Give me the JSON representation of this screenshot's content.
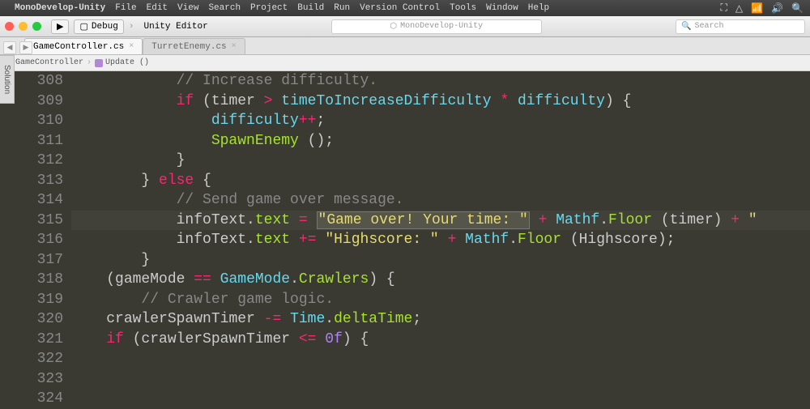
{
  "menubar": {
    "app": "MonoDevelop-Unity",
    "items": [
      "File",
      "Edit",
      "View",
      "Search",
      "Project",
      "Build",
      "Run",
      "Version Control",
      "Tools",
      "Window",
      "Help"
    ]
  },
  "toolbar": {
    "config": "Debug",
    "target": "Unity Editor",
    "center_title": "MonoDevelop-Unity",
    "search_placeholder": "Search"
  },
  "tabs": [
    {
      "label": "GameController.cs",
      "active": true
    },
    {
      "label": "TurretEnemy.cs",
      "active": false
    }
  ],
  "breadcrumb": {
    "class": "GameController",
    "method": "Update ()"
  },
  "sidebar_tab": "Solution",
  "lines": {
    "start": 308,
    "rows": [
      {
        "n": 308,
        "indent": "            ",
        "tokens": [
          {
            "t": "// Increase difficulty.",
            "c": "cmt"
          }
        ]
      },
      {
        "n": 309,
        "indent": "            ",
        "tokens": [
          {
            "t": "if",
            "c": "kw"
          },
          {
            "t": " (timer ",
            "c": "pn"
          },
          {
            "t": ">",
            "c": "op"
          },
          {
            "t": " timeToIncreaseDifficulty ",
            "c": "id"
          },
          {
            "t": "*",
            "c": "op"
          },
          {
            "t": " difficulty",
            "c": "id"
          },
          {
            "t": ") {",
            "c": "pn"
          }
        ]
      },
      {
        "n": 310,
        "indent": "                ",
        "tokens": [
          {
            "t": "difficulty",
            "c": "id"
          },
          {
            "t": "++",
            "c": "op"
          },
          {
            "t": ";",
            "c": "pn"
          }
        ]
      },
      {
        "n": 311,
        "indent": "                ",
        "tokens": [
          {
            "t": "SpawnEnemy",
            "c": "call"
          },
          {
            "t": " ();",
            "c": "pn"
          }
        ]
      },
      {
        "n": 312,
        "indent": "            ",
        "tokens": [
          {
            "t": "}",
            "c": "pn"
          }
        ]
      },
      {
        "n": 313,
        "indent": "        ",
        "tokens": [
          {
            "t": "} ",
            "c": "pn"
          },
          {
            "t": "else",
            "c": "kw"
          },
          {
            "t": " {",
            "c": "pn"
          }
        ]
      },
      {
        "n": 314,
        "indent": "            ",
        "tokens": [
          {
            "t": "// Send game over message.",
            "c": "cmt"
          }
        ]
      },
      {
        "n": 315,
        "hl": true,
        "indent": "            ",
        "tokens": [
          {
            "t": "infoText",
            "c": "pn"
          },
          {
            "t": ".",
            "c": "pn"
          },
          {
            "t": "text",
            "c": "prop"
          },
          {
            "t": " ",
            "c": "pn"
          },
          {
            "t": "=",
            "c": "op"
          },
          {
            "t": " ",
            "c": "pn"
          },
          {
            "t": "\"Game over! Your time: \"",
            "c": "str",
            "box": true
          },
          {
            "t": " ",
            "c": "pn"
          },
          {
            "t": "+",
            "c": "op"
          },
          {
            "t": " Mathf",
            "c": "id"
          },
          {
            "t": ".",
            "c": "pn"
          },
          {
            "t": "Floor",
            "c": "call"
          },
          {
            "t": " (timer) ",
            "c": "pn"
          },
          {
            "t": "+",
            "c": "op"
          },
          {
            "t": " ",
            "c": "pn"
          },
          {
            "t": "\"",
            "c": "str"
          }
        ]
      },
      {
        "n": 316,
        "indent": "            ",
        "tokens": [
          {
            "t": "infoText",
            "c": "pn"
          },
          {
            "t": ".",
            "c": "pn"
          },
          {
            "t": "text",
            "c": "prop"
          },
          {
            "t": " ",
            "c": "pn"
          },
          {
            "t": "+=",
            "c": "op"
          },
          {
            "t": " ",
            "c": "pn"
          },
          {
            "t": "\"Highscore: \"",
            "c": "str"
          },
          {
            "t": " ",
            "c": "pn"
          },
          {
            "t": "+",
            "c": "op"
          },
          {
            "t": " Mathf",
            "c": "id"
          },
          {
            "t": ".",
            "c": "pn"
          },
          {
            "t": "Floor",
            "c": "call"
          },
          {
            "t": " (Highscore);",
            "c": "pn"
          }
        ]
      },
      {
        "n": 317,
        "indent": "        ",
        "tokens": [
          {
            "t": "}",
            "c": "pn"
          }
        ]
      },
      {
        "n": 318,
        "indent": "",
        "tokens": []
      },
      {
        "n": 319,
        "indent": "",
        "tokens": []
      },
      {
        "n": 320,
        "indent": "    ",
        "tokens": [
          {
            "t": "(gameMode ",
            "c": "pn"
          },
          {
            "t": "==",
            "c": "op"
          },
          {
            "t": " GameMode",
            "c": "type"
          },
          {
            "t": ".",
            "c": "pn"
          },
          {
            "t": "Crawlers",
            "c": "prop"
          },
          {
            "t": ") {",
            "c": "pn"
          }
        ]
      },
      {
        "n": 321,
        "indent": "        ",
        "tokens": [
          {
            "t": "// Crawler game logic.",
            "c": "cmt"
          }
        ]
      },
      {
        "n": 322,
        "indent": "",
        "tokens": []
      },
      {
        "n": 323,
        "indent": "    ",
        "tokens": [
          {
            "t": "crawlerSpawnTimer ",
            "c": "pn"
          },
          {
            "t": "-=",
            "c": "op"
          },
          {
            "t": " Time",
            "c": "id"
          },
          {
            "t": ".",
            "c": "pn"
          },
          {
            "t": "deltaTime",
            "c": "prop"
          },
          {
            "t": ";",
            "c": "pn"
          }
        ]
      },
      {
        "n": 324,
        "indent": "    ",
        "tokens": [
          {
            "t": "if",
            "c": "kw"
          },
          {
            "t": " (crawlerSpawnTimer ",
            "c": "pn"
          },
          {
            "t": "<=",
            "c": "op"
          },
          {
            "t": " ",
            "c": "pn"
          },
          {
            "t": "0f",
            "c": "num"
          },
          {
            "t": ") {",
            "c": "pn"
          }
        ]
      }
    ]
  }
}
